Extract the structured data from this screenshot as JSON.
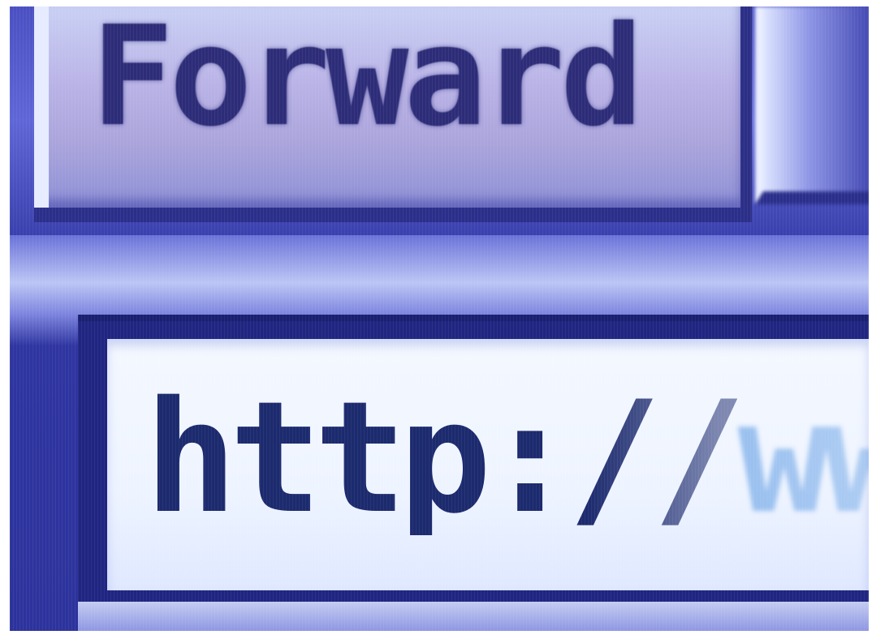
{
  "toolbar": {
    "forward_label": "Forward"
  },
  "address_bar": {
    "typed_prefix": "http://",
    "typed_faded": "ww",
    "value": "http://ww"
  },
  "colors": {
    "accent": "#3f44b8",
    "text_dark": "#1c2a6e",
    "input_background": "#f4f8ff"
  }
}
